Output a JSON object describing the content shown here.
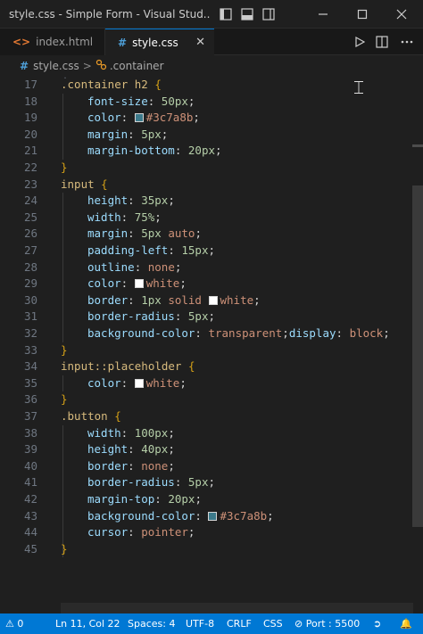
{
  "window": {
    "title": "style.css - Simple Form - Visual Stud..."
  },
  "tabs": [
    {
      "label": "index.html",
      "glyph": "<>"
    },
    {
      "label": "style.css",
      "glyph": "#",
      "close": "✕"
    }
  ],
  "breadcrumb": {
    "file": "style.css",
    "separator": ">",
    "symbol": ".container"
  },
  "editor": {
    "line_numbers": [
      "17",
      "18",
      "19",
      "20",
      "21",
      "22",
      "23",
      "24",
      "25",
      "26",
      "27",
      "28",
      "29",
      "30",
      "31",
      "32",
      "33",
      "34",
      "35",
      "36",
      "37",
      "38",
      "39",
      "40",
      "41",
      "42",
      "43",
      "44",
      "45"
    ]
  },
  "code": {
    "l17": {
      "sel": ".container h2",
      "brace": " {"
    },
    "l18": {
      "prop": "font-size",
      "num": "50px"
    },
    "l19": {
      "prop": "color",
      "val": "#3c7a8b"
    },
    "l20": {
      "prop": "margin",
      "num": "5px"
    },
    "l21": {
      "prop": "margin-bottom",
      "num": "20px"
    },
    "l22": {
      "brace": "}"
    },
    "l23": {
      "sel": "input",
      "brace": " {"
    },
    "l24": {
      "prop": "height",
      "num": "35px"
    },
    "l25": {
      "prop": "width",
      "num": "75%"
    },
    "l26": {
      "prop": "margin",
      "num": "5px",
      "val": "auto"
    },
    "l27": {
      "prop": "padding-left",
      "num": "15px"
    },
    "l28": {
      "prop": "outline",
      "val": "none"
    },
    "l29": {
      "prop": "color",
      "val": "white"
    },
    "l30": {
      "prop": "border",
      "num": "1px",
      "val": "solid",
      "val2": "white"
    },
    "l31": {
      "prop": "border-radius",
      "num": "5px"
    },
    "l32": {
      "prop": "background-color",
      "val": "transparent",
      "prop2": "display",
      "val2": "block"
    },
    "l33": {
      "brace": "}"
    },
    "l34": {
      "sel": "input::placeholder",
      "brace": " {"
    },
    "l35": {
      "prop": "color",
      "val": "white"
    },
    "l36": {
      "brace": "}"
    },
    "l37": {
      "sel": ".button",
      "brace": " {"
    },
    "l38": {
      "prop": "width",
      "num": "100px"
    },
    "l39": {
      "prop": "height",
      "num": "40px"
    },
    "l40": {
      "prop": "border",
      "val": "none"
    },
    "l41": {
      "prop": "border-radius",
      "num": "5px"
    },
    "l42": {
      "prop": "margin-top",
      "num": "20px"
    },
    "l43": {
      "prop": "background-color",
      "val": "#3c7a8b"
    },
    "l44": {
      "prop": "cursor",
      "val": "pointer"
    },
    "l45": {
      "brace": "}"
    }
  },
  "colors": {
    "accent": "#0078d4",
    "swatch_teal": "#3c7a8b",
    "swatch_white": "#ffffff"
  },
  "statusbar": {
    "position": "Ln 11, Col 22",
    "spaces": "Spaces: 4",
    "encoding": "UTF-8",
    "eol": "CRLF",
    "language": "CSS",
    "port": "Port : 5500",
    "errors": "0"
  },
  "icons": {
    "layout_sidebar_left": "layout-sidebar-left-icon",
    "layout_panel": "layout-panel-icon",
    "layout_sidebar_right": "layout-sidebar-right-icon",
    "minimize": "minimize-icon",
    "maximize": "maximize-icon",
    "close": "close-icon",
    "run": "run-icon",
    "split_editor": "split-editor-icon",
    "more": "more-actions-icon",
    "remote": "remote-icon",
    "bell": "bell-icon"
  }
}
